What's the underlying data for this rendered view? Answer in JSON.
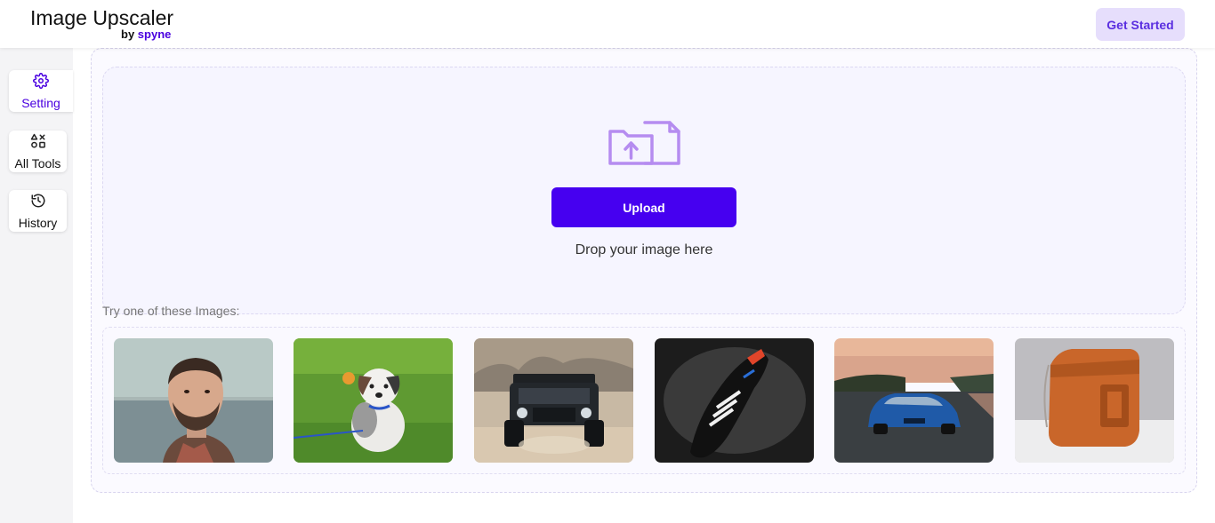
{
  "header": {
    "app_title": "Image Upscaler",
    "by_label": "by",
    "brand_label": "spyne",
    "get_started_label": "Get Started"
  },
  "sidebar": {
    "items": [
      {
        "label": "Setting",
        "icon": "gear-icon",
        "active": true
      },
      {
        "label": "All Tools",
        "icon": "shapes-icon",
        "active": false
      },
      {
        "label": "History",
        "icon": "history-icon",
        "active": false
      }
    ]
  },
  "upload": {
    "button_label": "Upload",
    "drop_text": "Drop your image here"
  },
  "samples": {
    "label": "Try one of these Images:",
    "images": [
      {
        "subject": "man-portrait"
      },
      {
        "subject": "puppy-on-grass"
      },
      {
        "subject": "black-jeep"
      },
      {
        "subject": "black-sneaker"
      },
      {
        "subject": "blue-sports-car"
      },
      {
        "subject": "orange-leather-bag"
      }
    ]
  },
  "colors": {
    "accent": "#4600f0",
    "accent_light": "#e6defc",
    "icon_purple": "#b58cf0"
  }
}
